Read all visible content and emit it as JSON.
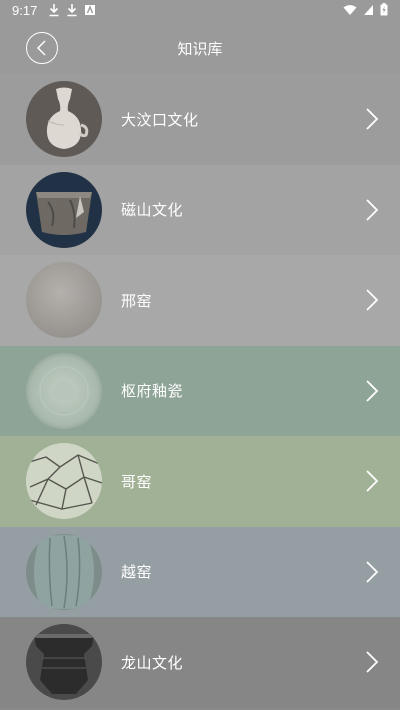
{
  "status_bar": {
    "time": "9:17",
    "left_icons": [
      "download-icon",
      "download-icon",
      "app-notification-icon"
    ],
    "right_icons": [
      "wifi-icon",
      "signal-icon",
      "battery-charging-icon"
    ]
  },
  "header": {
    "title": "知识库",
    "back_icon": "chevron-left-icon"
  },
  "items": [
    {
      "label": "大汶口文化",
      "bg": "#9c9c9c",
      "thumb": "white-pottery-jar"
    },
    {
      "label": "磁山文化",
      "bg": "#a3a3a3",
      "thumb": "dark-pottery-cup"
    },
    {
      "label": "邢窑",
      "bg": "#a8a8a8",
      "thumb": "white-porcelain-bowl"
    },
    {
      "label": "枢府釉瓷",
      "bg": "#8ea497",
      "thumb": "celadon-bowl-top"
    },
    {
      "label": "哥窑",
      "bg": "#a1b196",
      "thumb": "crackle-glaze-bowl"
    },
    {
      "label": "越窑",
      "bg": "#949ea3",
      "thumb": "green-lobed-jar"
    },
    {
      "label": "龙山文化",
      "bg": "#868686",
      "thumb": "black-pottery-cup"
    }
  ]
}
